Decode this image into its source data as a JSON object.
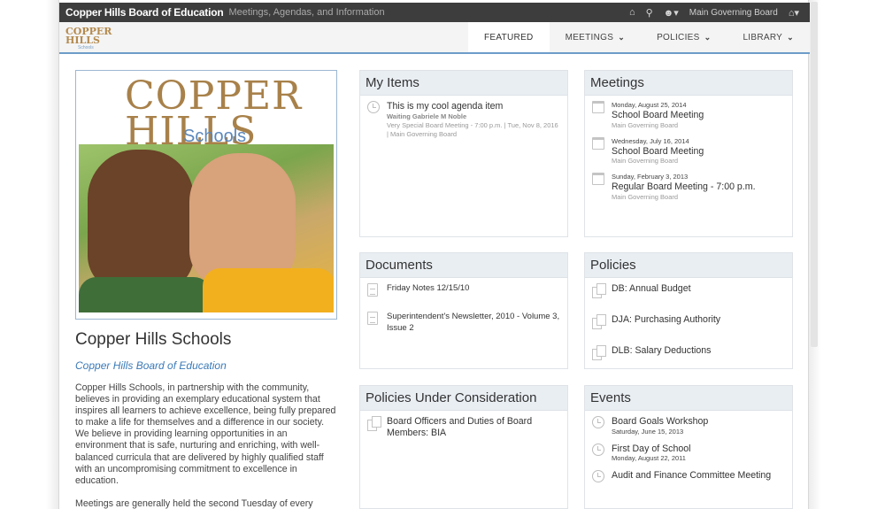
{
  "header": {
    "site_name": "Copper Hills Board of Education",
    "tagline": "Meetings, Agendas, and Information",
    "governing_board": "Main Governing Board",
    "icons": [
      "home-icon",
      "search-icon",
      "user-icon",
      "building-icon"
    ]
  },
  "logo": {
    "line1": "COPPER",
    "line2": "HILLS",
    "line3": "Schools"
  },
  "nav": {
    "items": [
      {
        "label": "FEATURED",
        "active": true
      },
      {
        "label": "MEETINGS"
      },
      {
        "label": "POLICIES"
      },
      {
        "label": "LIBRARY"
      }
    ]
  },
  "hero": {
    "logo_top": "COPPER",
    "logo_bottom": "HILLS",
    "logo_schools": "Schools"
  },
  "school": {
    "title": "Copper Hills Schools",
    "board_link": "Copper Hills Board of Education",
    "mission": "Copper Hills Schools, in partnership with the community, believes in providing an exemplary educational system that inspires all learners to achieve excellence, being fully prepared to make a life for themselves and a difference in our society. We believe in providing learning opportunities in an environment that is safe, nurturing and enriching, with well-balanced curricula that are delivered by highly qualified staff with an uncompromising commitment to excellence in education.",
    "meetings_note": "Meetings are generally held the second Tuesday of every"
  },
  "my_items": {
    "title": "My Items",
    "items": [
      {
        "title": "This is my cool agenda item",
        "status": "Waiting Gabriele M Noble",
        "meta": "Very Special Board Meeting - 7:00 p.m. | Tue, Nov 8, 2016 | Main Governing Board"
      }
    ]
  },
  "meetings": {
    "title": "Meetings",
    "items": [
      {
        "date": "Monday, August 25, 2014",
        "title": "School Board Meeting",
        "board": "Main Governing Board"
      },
      {
        "date": "Wednesday, July 16, 2014",
        "title": "School Board Meeting",
        "board": "Main Governing Board"
      },
      {
        "date": "Sunday, February 3, 2013",
        "title": "Regular Board Meeting - 7:00 p.m.",
        "board": "Main Governing Board"
      }
    ]
  },
  "documents": {
    "title": "Documents",
    "items": [
      {
        "title": "Friday Notes 12/15/10"
      },
      {
        "title": "Superintendent's Newsletter, 2010 - Volume 3, Issue 2"
      }
    ]
  },
  "policies": {
    "title": "Policies",
    "items": [
      {
        "title": "DB: Annual Budget"
      },
      {
        "title": "DJA: Purchasing Authority"
      },
      {
        "title": "DLB: Salary Deductions"
      }
    ]
  },
  "policies_consideration": {
    "title": "Policies Under Consideration",
    "items": [
      {
        "title": "Board Officers and Duties of Board Members: BIA"
      }
    ]
  },
  "events": {
    "title": "Events",
    "items": [
      {
        "title": "Board Goals Workshop",
        "date": "Saturday, June 15, 2013"
      },
      {
        "title": "First Day of School",
        "date": "Monday, August 22, 2011"
      },
      {
        "title": "Audit and Finance Committee Meeting",
        "date": ""
      }
    ]
  }
}
